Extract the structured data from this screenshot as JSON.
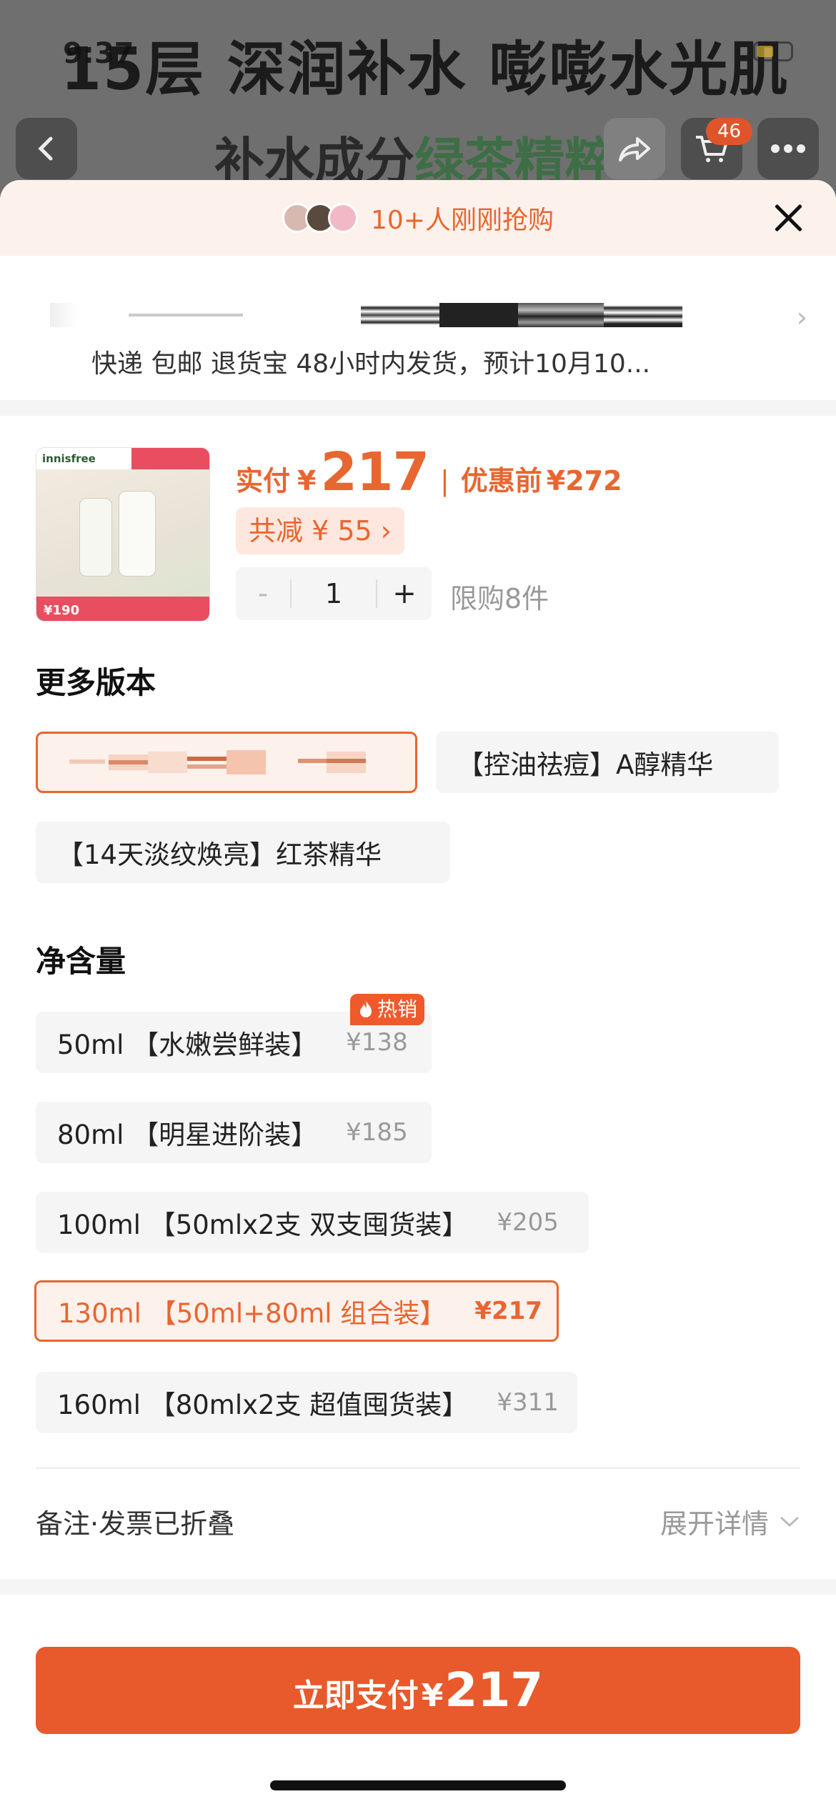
{
  "background": {
    "status_time": "9:37",
    "banner_text": "15层 深润补水 嘭嘭水光肌",
    "sub_text_prefix": "补水成分",
    "sub_text_highlight": "绿茶精粹",
    "cart_count": "46",
    "icons": [
      "back-icon",
      "share-icon",
      "cart-icon",
      "more-icon"
    ]
  },
  "buyers": {
    "text": "10+人刚刚抢购"
  },
  "delivery": {
    "text": "快递 包邮 退货宝 48小时内发货，预计10月10..."
  },
  "product": {
    "thumb_brand": "innisfree",
    "thumb_price": "¥190",
    "pay_label": "实付",
    "currency": "¥",
    "pay_amount": "217",
    "pre_label": "优惠前",
    "pre_amount": "¥272",
    "discount": "共减 ¥ 55 ›",
    "quantity": "1",
    "minus": "-",
    "plus": "+",
    "limit": "限购8件"
  },
  "versions": {
    "title": "更多版本",
    "items": [
      {
        "label": "",
        "selected": true
      },
      {
        "label": "【控油祛痘】A醇精华",
        "selected": false
      },
      {
        "label": "【14天淡纹焕亮】红茶精华",
        "selected": false
      }
    ]
  },
  "volume": {
    "title": "净含量",
    "hot_tag": "热销",
    "items": [
      {
        "label": "50ml 【水嫩尝鲜装】",
        "price": "¥138",
        "selected": false
      },
      {
        "label": "80ml 【明星进阶装】",
        "price": "¥185",
        "selected": false
      },
      {
        "label": "100ml 【50mlx2支 双支囤货装】",
        "price": "¥205",
        "selected": false
      },
      {
        "label": "130ml 【50ml+80ml 组合装】",
        "price": "¥217",
        "selected": true
      },
      {
        "label": "160ml 【80mlx2支 超值囤货装】",
        "price": "¥311",
        "selected": false
      }
    ]
  },
  "remark": {
    "label": "备注·发票已折叠",
    "expand": "展开详情"
  },
  "pay_button": {
    "text": "立即支付",
    "currency": "¥",
    "amount": "217"
  },
  "colors": {
    "accent": "#e8662f",
    "button": "#e85a2b",
    "hot": "#ee5a2c"
  }
}
